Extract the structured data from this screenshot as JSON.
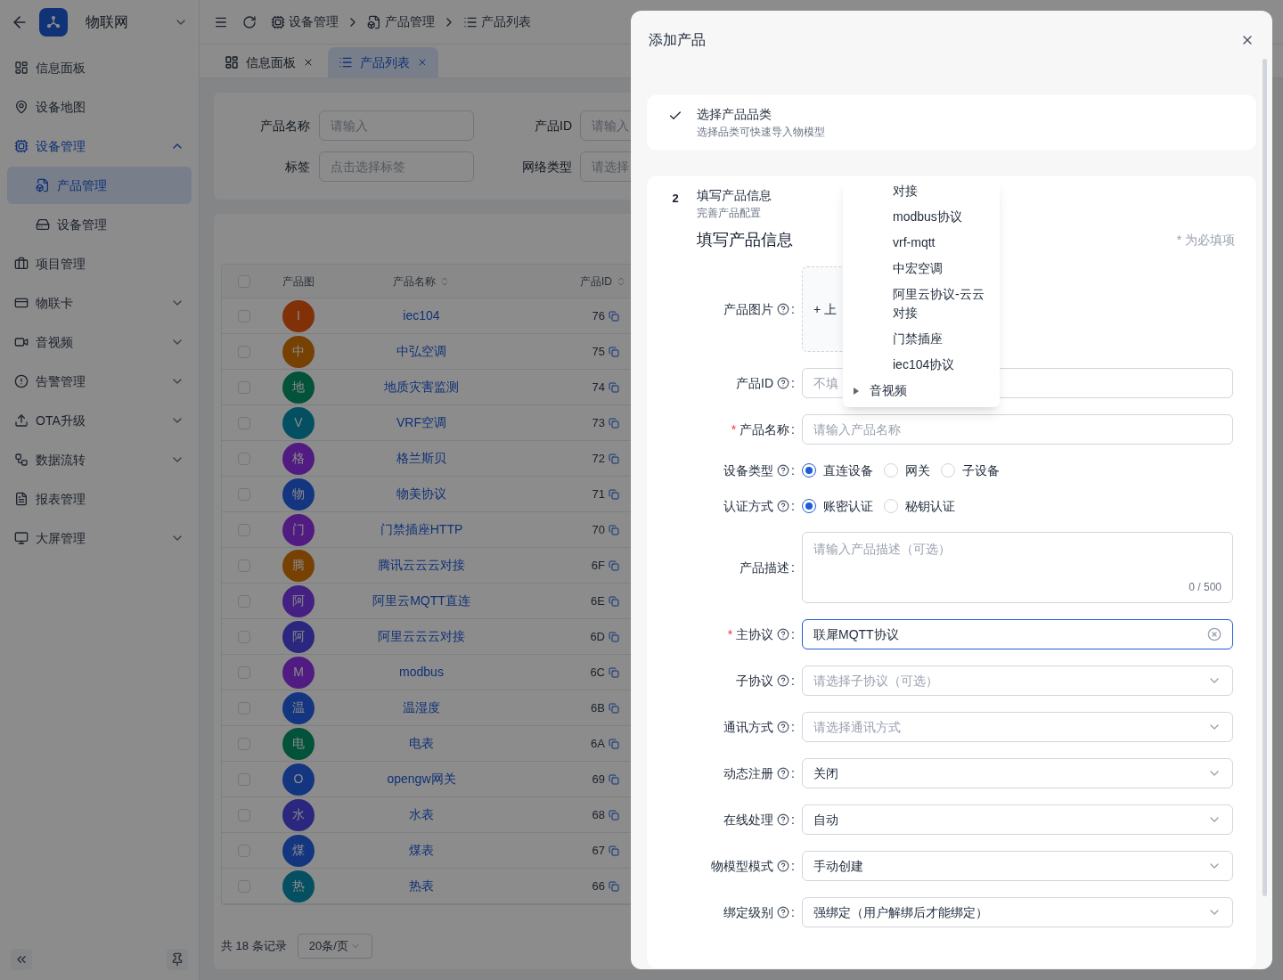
{
  "sidebar": {
    "title": "物联网",
    "items": [
      {
        "label": "信息面板",
        "selected": false,
        "has_arrow": false
      },
      {
        "label": "设备地图",
        "selected": false,
        "has_arrow": false
      },
      {
        "label": "设备管理",
        "selected": true,
        "has_arrow": true,
        "expanded": true,
        "children": [
          {
            "label": "产品管理",
            "selected": true
          },
          {
            "label": "设备管理",
            "selected": false
          }
        ]
      },
      {
        "label": "项目管理",
        "selected": false,
        "has_arrow": false
      },
      {
        "label": "物联卡",
        "selected": false,
        "has_arrow": true,
        "expanded": false
      },
      {
        "label": "音视频",
        "selected": false,
        "has_arrow": true,
        "expanded": false
      },
      {
        "label": "告警管理",
        "selected": false,
        "has_arrow": true,
        "expanded": false
      },
      {
        "label": "OTA升级",
        "selected": false,
        "has_arrow": true,
        "expanded": false
      },
      {
        "label": "数据流转",
        "selected": false,
        "has_arrow": true,
        "expanded": false
      },
      {
        "label": "报表管理",
        "selected": false,
        "has_arrow": false
      },
      {
        "label": "大屏管理",
        "selected": false,
        "has_arrow": true,
        "expanded": false
      }
    ]
  },
  "breadcrumb": [
    "设备管理",
    "产品管理",
    "产品列表"
  ],
  "tabs": [
    {
      "label": "信息面板",
      "selected": false
    },
    {
      "label": "产品列表",
      "selected": true
    }
  ],
  "filters": [
    [
      {
        "label": "产品名称",
        "placeholder": "请输入"
      },
      {
        "label": "产品ID",
        "placeholder": "请输入"
      }
    ],
    [
      {
        "label": "标签",
        "placeholder": "点击选择标签"
      },
      {
        "label": "网络类型",
        "placeholder": "请选择"
      }
    ]
  ],
  "table": {
    "all_checked": false,
    "columns": [
      "产品图",
      "产品名称",
      "产品ID"
    ],
    "rows": [
      {
        "checked": false,
        "avatar": "I",
        "color": "#813007",
        "name": "iec104",
        "id": "76"
      },
      {
        "checked": false,
        "avatar": "中",
        "color": "#774103",
        "name": "中弘空调",
        "id": "75"
      },
      {
        "checked": false,
        "avatar": "地",
        "color": "#03533a",
        "name": "地质灾害监测",
        "id": "74"
      },
      {
        "checked": false,
        "avatar": "V",
        "color": "#045062",
        "name": "VRF空调",
        "id": "73"
      },
      {
        "checked": false,
        "avatar": "格",
        "color": "#511c81",
        "name": "格兰斯贝",
        "id": "72"
      },
      {
        "checked": false,
        "avatar": "物",
        "color": "#143681",
        "name": "物美协议",
        "id": "71"
      },
      {
        "checked": false,
        "avatar": "门",
        "color": "#511c81",
        "name": "门禁插座HTTP",
        "id": "70"
      },
      {
        "checked": false,
        "avatar": "腾",
        "color": "#774103",
        "name": "腾讯云云云对接",
        "id": "6F"
      },
      {
        "checked": false,
        "avatar": "阿",
        "color": "#442082",
        "name": "阿里云MQTT直连",
        "id": "6E"
      },
      {
        "checked": false,
        "avatar": "阿",
        "color": "#2b277e",
        "name": "阿里云云云对接",
        "id": "6D"
      },
      {
        "checked": false,
        "avatar": "M",
        "color": "#511c81",
        "name": "modbus",
        "id": "6C"
      },
      {
        "checked": false,
        "avatar": "温",
        "color": "#143681",
        "name": "温湿度",
        "id": "6B"
      },
      {
        "checked": false,
        "avatar": "电",
        "color": "#03533a",
        "name": "电表",
        "id": "6A"
      },
      {
        "checked": false,
        "avatar": "O",
        "color": "#143681",
        "name": "opengw网关",
        "id": "69"
      },
      {
        "checked": false,
        "avatar": "水",
        "color": "#2b277e",
        "name": "水表",
        "id": "68"
      },
      {
        "checked": false,
        "avatar": "煤",
        "color": "#143681",
        "name": "煤表",
        "id": "67"
      },
      {
        "checked": false,
        "avatar": "热",
        "color": "#045062",
        "name": "热表",
        "id": "66"
      }
    ]
  },
  "pagination": {
    "total": "共 18 条记录",
    "page_size": "20条/页"
  },
  "modal": {
    "title": "添加产品",
    "steps": [
      {
        "done": true,
        "title": "选择产品品类",
        "subtitle": "选择品类可快速导入物模型"
      },
      {
        "done": false,
        "number": "2",
        "title": "填写产品信息",
        "subtitle": "完善产品配置"
      }
    ],
    "form_title": "填写产品信息",
    "required_note": "* 为必填项",
    "fields": [
      {
        "kind": "upload",
        "label": "产品图片",
        "colon": ":",
        "help": true,
        "text": "+ 上"
      },
      {
        "kind": "input",
        "label": "产品ID",
        "colon": ":",
        "help": true,
        "placeholder": "不填"
      },
      {
        "kind": "input",
        "required_mark": "*",
        "label": "产品名称",
        "colon": ":",
        "help": false,
        "placeholder": "请输入产品名称"
      },
      {
        "kind": "radio",
        "label": "设备类型",
        "colon": ":",
        "help": true,
        "options": [
          {
            "label": "直连设备",
            "selected": true
          },
          {
            "label": "网关",
            "selected": false
          },
          {
            "label": "子设备",
            "selected": false
          }
        ]
      },
      {
        "kind": "radio",
        "label": "认证方式",
        "colon": ":",
        "help": true,
        "options": [
          {
            "label": "账密认证",
            "selected": true
          },
          {
            "label": "秘钥认证",
            "selected": false
          }
        ]
      },
      {
        "kind": "textarea",
        "label": "产品描述",
        "colon": ":",
        "help": false,
        "placeholder": "请输入产品描述（可选）",
        "counter": "0 / 500"
      },
      {
        "kind": "select",
        "required_mark": "*",
        "label": "主协议",
        "colon": ":",
        "help": true,
        "value": "联犀MQTT协议",
        "focused": true
      },
      {
        "kind": "select",
        "label": "子协议",
        "colon": ":",
        "help": true,
        "placeholder": "请选择子协议（可选）",
        "focused": false
      },
      {
        "kind": "select",
        "label": "通讯方式",
        "colon": ":",
        "help": true,
        "placeholder": "请选择通讯方式",
        "focused": false
      },
      {
        "kind": "select",
        "label": "动态注册",
        "colon": ":",
        "help": true,
        "value": "关闭",
        "focused": false
      },
      {
        "kind": "select",
        "label": "在线处理",
        "colon": ":",
        "help": true,
        "value": "自动",
        "focused": false
      },
      {
        "kind": "select",
        "label": "物模型模式",
        "colon": ":",
        "help": true,
        "value": "手动创建",
        "focused": false
      },
      {
        "kind": "select",
        "label": "绑定级别",
        "colon": ":",
        "help": true,
        "value": "强绑定（用户解绑后才能绑定）",
        "focused": false
      }
    ],
    "dropdown": [
      {
        "kind": "option",
        "label": "对接"
      },
      {
        "kind": "option",
        "label": "modbus协议"
      },
      {
        "kind": "option",
        "label": "vrf-mqtt"
      },
      {
        "kind": "option",
        "label": "中宏空调"
      },
      {
        "kind": "option",
        "label": "阿里云协议-云云对接"
      },
      {
        "kind": "option",
        "label": "门禁插座"
      },
      {
        "kind": "option",
        "label": "iec104协议"
      },
      {
        "kind": "group",
        "label": "音视频"
      }
    ]
  }
}
